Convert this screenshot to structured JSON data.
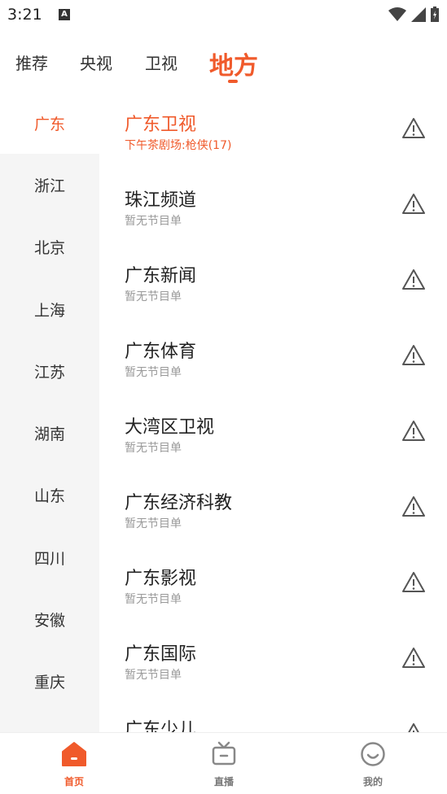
{
  "status_bar": {
    "time": "3:21",
    "notification_letter": "A"
  },
  "tabs": [
    {
      "label": "推荐"
    },
    {
      "label": "央视"
    },
    {
      "label": "卫视"
    },
    {
      "label": "地方"
    }
  ],
  "active_tab": "地方",
  "provinces": [
    {
      "label": "广东"
    },
    {
      "label": "浙江"
    },
    {
      "label": "北京"
    },
    {
      "label": "上海"
    },
    {
      "label": "江苏"
    },
    {
      "label": "湖南"
    },
    {
      "label": "山东"
    },
    {
      "label": "四川"
    },
    {
      "label": "安徽"
    },
    {
      "label": "重庆"
    }
  ],
  "channels": [
    {
      "name": "广东卫视",
      "program": "下午茶剧场:枪侠(17)"
    },
    {
      "name": "珠江频道",
      "program": "暂无节目单"
    },
    {
      "name": "广东新闻",
      "program": "暂无节目单"
    },
    {
      "name": "广东体育",
      "program": "暂无节目单"
    },
    {
      "name": "大湾区卫视",
      "program": "暂无节目单"
    },
    {
      "name": "广东经济科教",
      "program": "暂无节目单"
    },
    {
      "name": "广东影视",
      "program": "暂无节目单"
    },
    {
      "name": "广东国际",
      "program": "暂无节目单"
    },
    {
      "name": "广东少儿",
      "program": ""
    }
  ],
  "bottom_nav": [
    {
      "label": "首页",
      "icon": "home-icon"
    },
    {
      "label": "直播",
      "icon": "tv-icon"
    },
    {
      "label": "我的",
      "icon": "smile-icon"
    }
  ],
  "colors": {
    "accent": "#f05a2b",
    "sidebar_bg": "#f5f5f5",
    "secondary_text": "#999999"
  }
}
